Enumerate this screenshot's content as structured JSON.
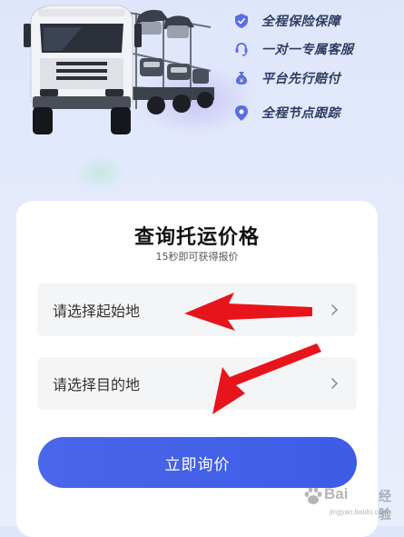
{
  "features": [
    {
      "icon": "shield-check-icon",
      "label": "全程保险保障"
    },
    {
      "icon": "customer-service-icon",
      "label": "一对一专属客服"
    },
    {
      "icon": "money-bag-icon",
      "label": "平台先行赔付"
    },
    {
      "icon": "location-pin-icon",
      "label": "全程节点跟踪"
    }
  ],
  "quote_card": {
    "title": "查询托运价格",
    "subtitle": "15秒即可获得报价",
    "origin_placeholder": "请选择起始地",
    "destination_placeholder": "请选择目的地",
    "submit_label": "立即询价"
  },
  "watermark": {
    "brand": "Bai",
    "brand_cn": "经验",
    "url": "jingyan.baidu.com"
  },
  "colors": {
    "accent": "#4a66ea",
    "feature_icon": "#5a6ee0",
    "annotation_arrow": "#e8141c"
  }
}
